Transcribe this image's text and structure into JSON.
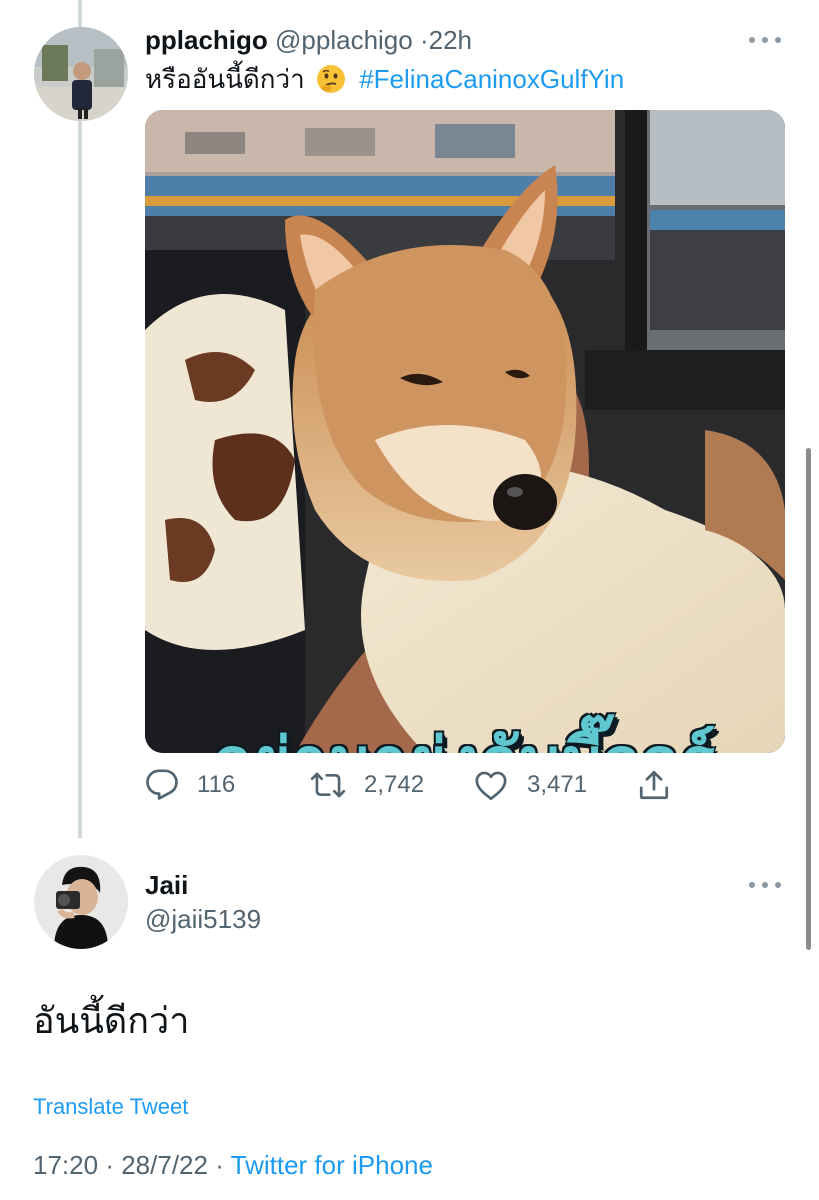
{
  "quoted_tweet": {
    "display_name": "pplachigo",
    "handle": "@pplachigo",
    "separator": "·",
    "time": "22h",
    "text": "หรืออันนี้ดีกว่า",
    "emoji": "thinking-face",
    "hashtag": "#FelinaCaninoxGulfYin",
    "media_caption": "อย่ามายุ่งกับมี๊วอร์",
    "stats": {
      "replies": "116",
      "retweets": "2,742",
      "likes": "3,471"
    }
  },
  "reply_tweet": {
    "display_name": "Jaii",
    "handle": "@jaii5139",
    "text": "อันนี้ดีกว่า",
    "translate_label": "Translate Tweet",
    "time": "17:20",
    "date": "28/7/22",
    "sep1": "·",
    "sep2": "·",
    "source": "Twitter for iPhone"
  },
  "colors": {
    "accent": "#1d9bf0",
    "secondary_text": "#536471",
    "thread_line": "#cfd9de",
    "caption": "#5ec7d0"
  },
  "icons": [
    "reply-icon",
    "retweet-icon",
    "like-icon",
    "share-icon",
    "more-icon",
    "thinking-emoji"
  ]
}
